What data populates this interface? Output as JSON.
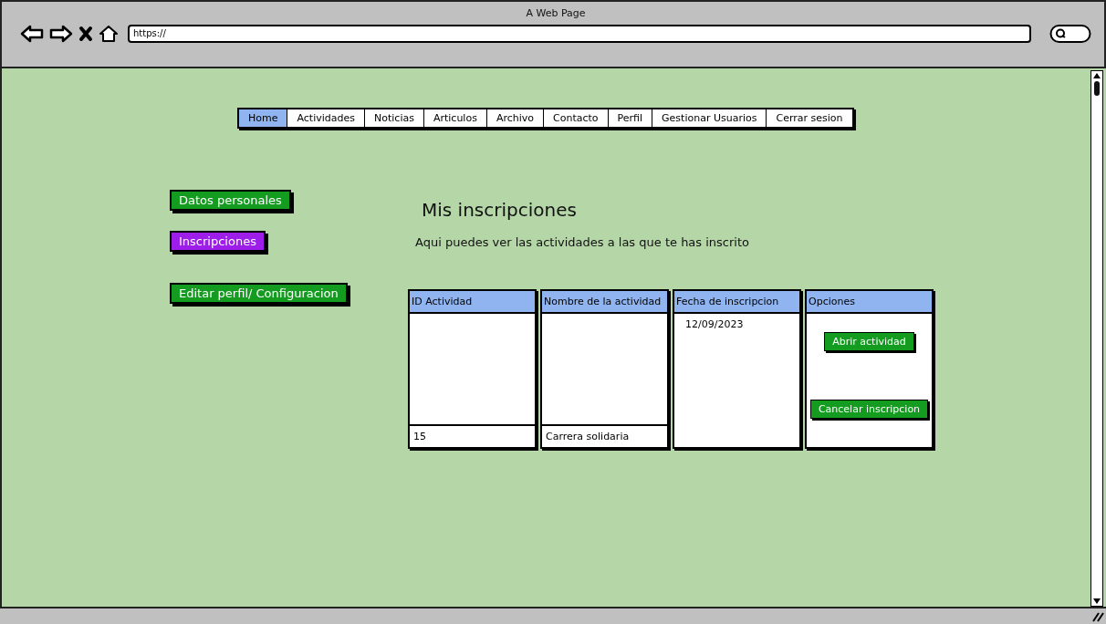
{
  "window": {
    "title": "A Web Page",
    "url": "https://"
  },
  "nav": [
    {
      "label": "Home",
      "selected": true
    },
    {
      "label": "Actividades",
      "selected": false
    },
    {
      "label": "Noticias",
      "selected": false
    },
    {
      "label": "Articulos",
      "selected": false
    },
    {
      "label": "Archivo",
      "selected": false
    },
    {
      "label": "Contacto",
      "selected": false
    },
    {
      "label": "Perfil",
      "selected": false
    },
    {
      "label": "Gestionar Usuarios",
      "selected": false
    },
    {
      "label": "Cerrar sesion",
      "selected": false
    }
  ],
  "side_buttons": [
    {
      "label": "Datos personales",
      "selected": false
    },
    {
      "label": "Inscripciones",
      "selected": true
    },
    {
      "label": "Editar perfil/ Configuracion",
      "selected": false
    }
  ],
  "heading": "Mis inscripciones",
  "description": "Aqui puedes ver las actividades a las que te has inscrito",
  "table": {
    "columns": [
      {
        "header": "ID Actividad",
        "kind": "footer_cell",
        "text": "15"
      },
      {
        "header": "Nombre de la actividad",
        "kind": "footer_cell",
        "text": "Carrera solidaria"
      },
      {
        "header": "Fecha de inscripcion",
        "kind": "top_text",
        "text": "12/09/2023"
      },
      {
        "header": "Opciones",
        "kind": "buttons",
        "buttons": [
          "Abrir actividad",
          "Cancelar inscripcion"
        ]
      }
    ]
  }
}
